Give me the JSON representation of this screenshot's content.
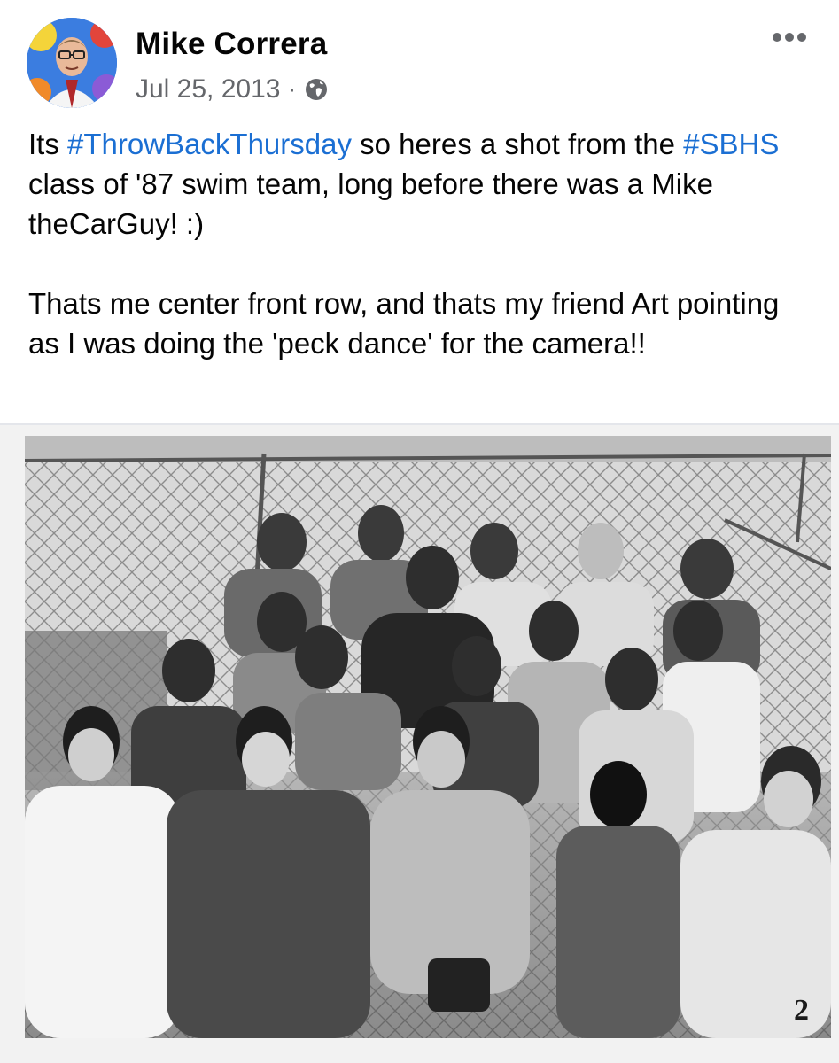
{
  "post": {
    "author": "Mike Correra",
    "date": "Jul 25, 2013",
    "separator": "·",
    "audience_icon": "globe-icon",
    "more_icon": "more-options-icon",
    "paragraph1": {
      "t1": "Its ",
      "hashtag1": "#ThrowBackThursday",
      "t2": " so heres a shot from the ",
      "hashtag2": "#SBHS",
      "t3": " class of '87 swim team, long before there was a Mike theCarGuy! :)"
    },
    "paragraph2": "Thats me center front row, and thats my friend Art pointing as I was doing the 'peck dance' for the camera!!",
    "photo": {
      "page_number": "2"
    }
  },
  "colors": {
    "hashtag": "#1b6fd3",
    "meta": "#65676b",
    "text": "#050505"
  }
}
